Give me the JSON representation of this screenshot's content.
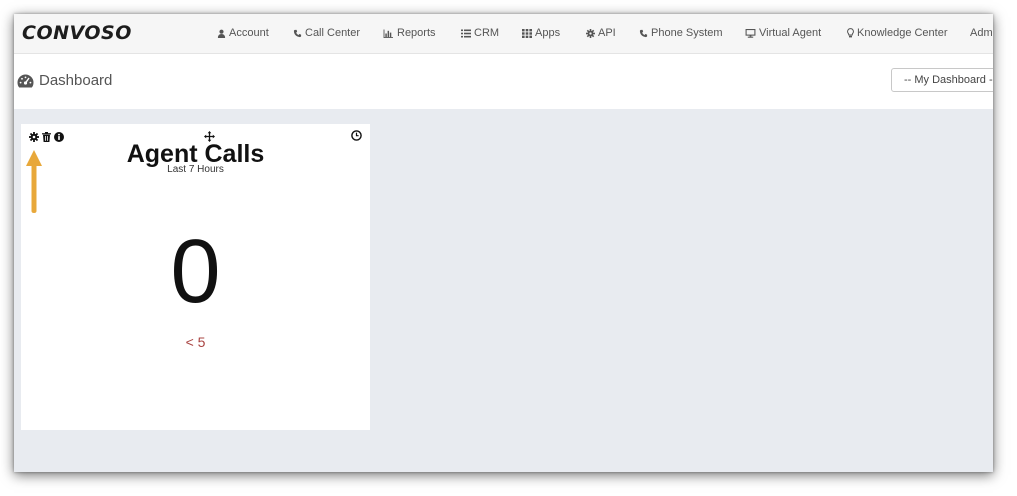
{
  "app": {
    "logo": "CONVOSO"
  },
  "nav": {
    "items": [
      {
        "label": "Account",
        "icon": "user-icon"
      },
      {
        "label": "Call Center",
        "icon": "phone-icon"
      },
      {
        "label": "Reports",
        "icon": "bar-chart-icon"
      },
      {
        "label": "CRM",
        "icon": "list-icon"
      },
      {
        "label": "Apps",
        "icon": "grid-icon"
      },
      {
        "label": "API",
        "icon": "gear-icon"
      },
      {
        "label": "Phone System",
        "icon": "phone-icon"
      },
      {
        "label": "Virtual Agent",
        "icon": "monitor-icon"
      },
      {
        "label": "Knowledge Center",
        "icon": "lightbulb-icon"
      },
      {
        "label": "Adm",
        "icon": ""
      }
    ]
  },
  "page": {
    "title": "Dashboard",
    "title_icon": "dashboard-gauge-icon",
    "dashboard_select_value": "-- My Dashboard --"
  },
  "widget": {
    "title": "Agent Calls",
    "subtitle": "Last 7 Hours",
    "value": "0",
    "threshold": "< 5",
    "tools": [
      "gear-icon",
      "trash-icon",
      "info-icon"
    ],
    "corner_icon": "clock-icon",
    "drag_icon": "move-icon"
  },
  "colors": {
    "threshold_text": "#a94442",
    "annotation_arrow": "#e8a83a",
    "content_background": "#e8ebf0"
  }
}
